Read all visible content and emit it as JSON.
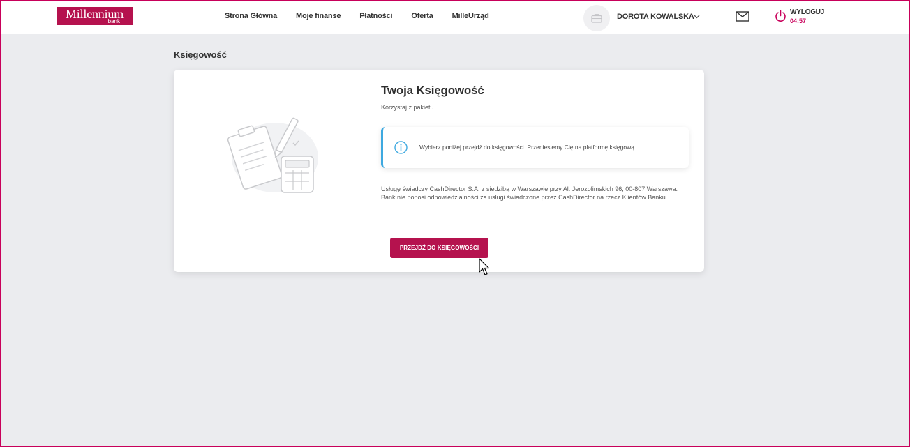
{
  "brand": {
    "name": "Millennium",
    "sub": "bank",
    "color": "#b5124e"
  },
  "nav": {
    "items": [
      {
        "label": "Strona Główna"
      },
      {
        "label": "Moje finanse"
      },
      {
        "label": "Płatności"
      },
      {
        "label": "Oferta"
      },
      {
        "label": "MilleUrząd"
      }
    ]
  },
  "user": {
    "name": "DOROTA KOWALSKA",
    "avatar_icon": "briefcase-icon"
  },
  "header_actions": {
    "mail_icon": "mail-icon",
    "logout_label": "WYLOGUJ",
    "session_timer": "04:57",
    "accent_color": "#c8005a"
  },
  "page": {
    "title": "Księgowość"
  },
  "card": {
    "title": "Twoja Księgowość",
    "subtitle": "Korzystaj z pakietu.",
    "info_text": "Wybierz poniżej przejdź do księgowości. Przeniesiemy Cię na platformę księgową.",
    "info_color": "#3ea9e0",
    "disclaimer": "Usługę świadczy CashDirector S.A. z siedzibą w Warszawie przy Al. Jerozolimskich 96, 00-807 Warszawa. Bank nie ponosi odpowiedzialności za usługi świadczone przez CashDirector na rzecz Klientów Banku.",
    "cta_label": "PRZEJDŹ DO KSIĘGOWOŚCI"
  }
}
